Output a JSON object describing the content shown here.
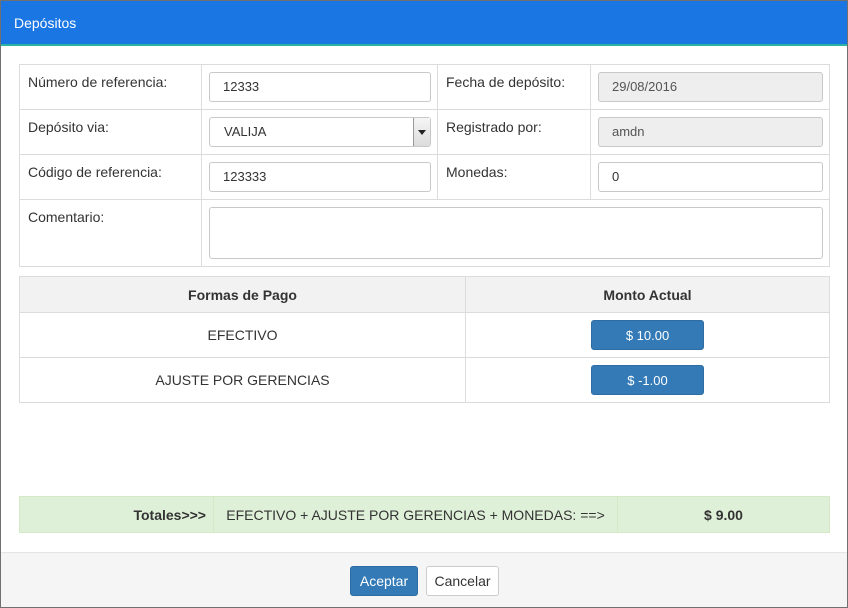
{
  "dialog": {
    "title": "Depósitos"
  },
  "form": {
    "numero_referencia": {
      "label": "Número de referencia:",
      "value": "12333"
    },
    "fecha_deposito": {
      "label": "Fecha de depósito:",
      "value": "29/08/2016"
    },
    "deposito_via": {
      "label": "Depósito via:",
      "value": "VALIJA"
    },
    "registrado_por": {
      "label": "Registrado por:",
      "value": "amdn"
    },
    "codigo_referencia": {
      "label": "Código de referencia:",
      "value": "123333"
    },
    "monedas": {
      "label": "Monedas:",
      "value": "0"
    },
    "comentario": {
      "label": "Comentario:",
      "value": ""
    }
  },
  "payments": {
    "headers": [
      "Formas de Pago",
      "Monto Actual"
    ],
    "rows": [
      {
        "forma": "EFECTIVO",
        "monto": "$ 10.00"
      },
      {
        "forma": "AJUSTE POR GERENCIAS",
        "monto": "$ -1.00"
      }
    ]
  },
  "totals": {
    "label": "Totales>>>",
    "formula": "EFECTIVO + AJUSTE POR GERENCIAS + MONEDAS: ==>",
    "value": "$ 9.00"
  },
  "footer": {
    "accept_label": "Aceptar",
    "cancel_label": "Cancelar"
  },
  "colors": {
    "titlebar": "#1976e3",
    "primary": "#337ab7",
    "totals_bg": "#dff0d8"
  }
}
